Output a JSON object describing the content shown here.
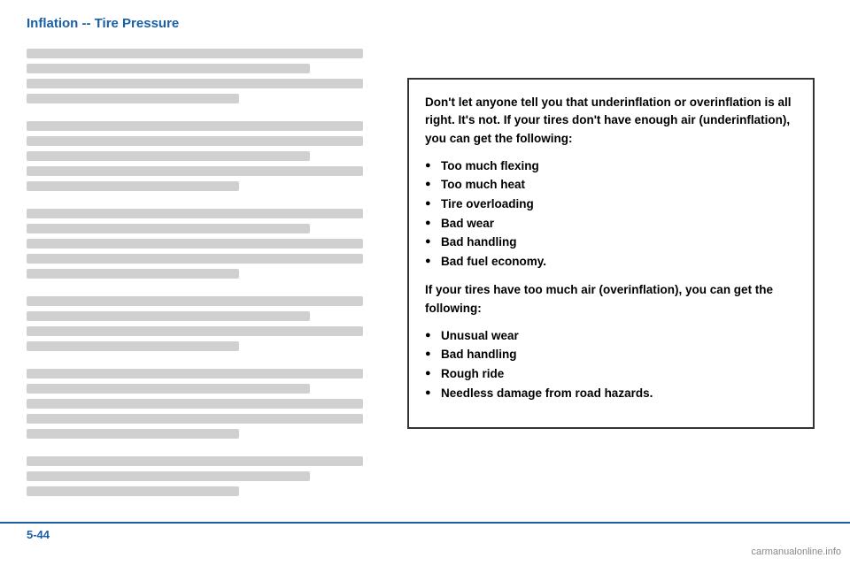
{
  "header": {
    "title": "Inflation -- Tire Pressure"
  },
  "footer": {
    "page_number": "5-44",
    "watermark": "carmanualonline.info"
  },
  "info_box": {
    "intro_text": "Don't let anyone tell you that underinflation or overinflation is all right. It's not. If your tires don't have enough air (underinflation), you can get the following:",
    "underinflation_bullets": [
      "Too much flexing",
      "Too much heat",
      "Tire overloading",
      "Bad wear",
      "Bad handling",
      "Bad fuel economy."
    ],
    "mid_text": "If your tires have too much air (overinflation), you can get the following:",
    "overinflation_bullets": [
      "Unusual wear",
      "Bad handling",
      "Rough ride",
      "Needless damage from road hazards."
    ]
  }
}
